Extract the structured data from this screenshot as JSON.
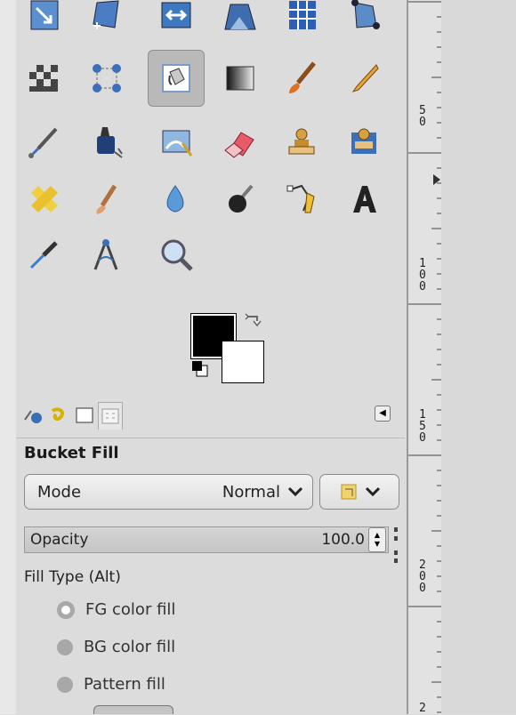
{
  "toolbox": {
    "tools": [
      {
        "name": "align-tool-icon"
      },
      {
        "name": "perspective-tool-icon"
      },
      {
        "name": "flip-tool-icon"
      },
      {
        "name": "cage-transform-tool-icon"
      },
      {
        "name": "warp-grid-tool-icon"
      },
      {
        "name": "unified-transform-tool-icon"
      },
      {
        "name": "checker-warp-tool-icon"
      },
      {
        "name": "handle-transform-tool-icon"
      },
      {
        "name": "bucket-fill-tool-icon"
      },
      {
        "name": "gradient-tool-icon"
      },
      {
        "name": "paintbrush-tool-icon"
      },
      {
        "name": "pencil-tool-icon"
      },
      {
        "name": "airbrush-tool-icon"
      },
      {
        "name": "ink-tool-icon"
      },
      {
        "name": "mypaint-brush-tool-icon"
      },
      {
        "name": "eraser-tool-icon"
      },
      {
        "name": "clone-tool-icon"
      },
      {
        "name": "perspective-clone-tool-icon"
      },
      {
        "name": "heal-tool-icon"
      },
      {
        "name": "smudge-tool-icon"
      },
      {
        "name": "blur-tool-icon"
      },
      {
        "name": "dodge-burn-tool-icon"
      },
      {
        "name": "paths-tool-icon"
      },
      {
        "name": "text-tool-icon"
      },
      {
        "name": "color-picker-tool-icon"
      },
      {
        "name": "measure-tool-icon"
      },
      {
        "name": "zoom-tool-icon"
      }
    ],
    "active_tool": "bucket-fill-tool-icon"
  },
  "colors": {
    "foreground": "#000000",
    "background": "#ffffff",
    "active_highlight": "#b9b9b9"
  },
  "ruler": {
    "labels": [
      "5\n0",
      "1\n0\n0",
      "1\n5\n0",
      "2\n0\n0",
      "2"
    ]
  },
  "tool_options": {
    "title": "Bucket Fill",
    "mode_label": "Mode",
    "mode_value": "Normal",
    "opacity_label": "Opacity",
    "opacity_value": "100.0",
    "fill_type_label": "Fill Type  (Alt)",
    "fill_options": [
      {
        "label": "FG color fill",
        "selected": true
      },
      {
        "label": "BG color fill",
        "selected": false
      },
      {
        "label": "Pattern fill",
        "selected": false
      }
    ]
  }
}
